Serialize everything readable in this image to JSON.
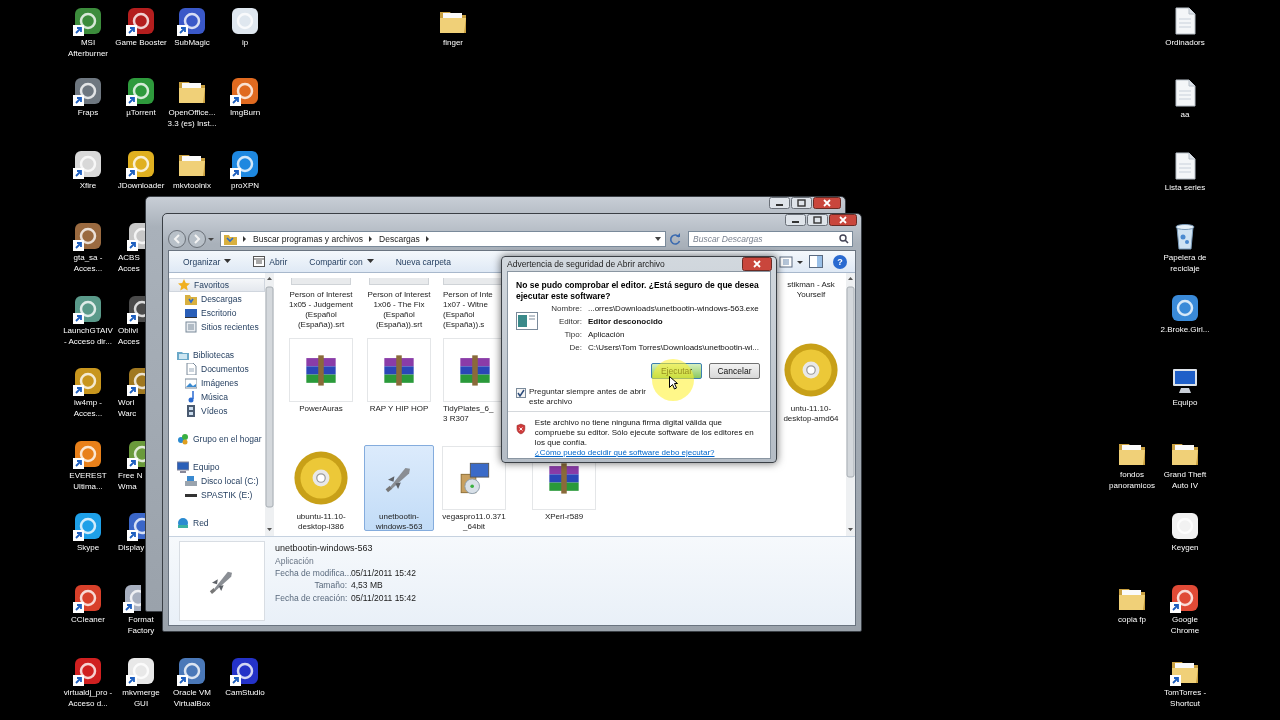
{
  "desktop_icons": [
    {
      "label": "MSI Afterburner",
      "kind": "app",
      "color": "#3c8c3c",
      "shortcut": true
    },
    {
      "label": "Fraps",
      "kind": "app",
      "color": "#6e7780",
      "shortcut": true
    },
    {
      "label": "Xfire",
      "kind": "app",
      "color": "#d8d8d8",
      "shortcut": true
    },
    {
      "label": "gta_sa - Acces...",
      "kind": "app",
      "color": "#9a6a40",
      "shortcut": true
    },
    {
      "label": "LaunchGTAIV - Acceso dir...",
      "kind": "app",
      "color": "#5a9a8a",
      "shortcut": true
    },
    {
      "label": "iw4mp - Acces...",
      "kind": "app",
      "color": "#c8961e",
      "shortcut": true
    },
    {
      "label": "EVEREST Ultima...",
      "kind": "app",
      "color": "#e8801a",
      "shortcut": true
    },
    {
      "label": "Skype",
      "kind": "app",
      "color": "#1ea0e8",
      "shortcut": true
    },
    {
      "label": "CCleaner",
      "kind": "app",
      "color": "#d8402a",
      "shortcut": true
    },
    {
      "label": "virtualdj_pro - Acceso d...",
      "kind": "app",
      "color": "#d02020",
      "shortcut": true
    },
    {
      "label": "Game Booster",
      "kind": "app",
      "color": "#b41e1e",
      "shortcut": true
    },
    {
      "label": "µTorrent",
      "kind": "app",
      "color": "#2e9a3c",
      "shortcut": true
    },
    {
      "label": "JDownloader",
      "kind": "app",
      "color": "#e0b020",
      "shortcut": true
    },
    {
      "label": "ACBS Acces",
      "kind": "app",
      "color": "#c8c8c8",
      "shortcut": true
    },
    {
      "label": "Oblivi Acces",
      "kind": "app",
      "color": "#4a4a4a",
      "shortcut": true
    },
    {
      "label": "Worl Warc",
      "kind": "app",
      "color": "#a07820",
      "shortcut": true
    },
    {
      "label": "Free N Wma",
      "kind": "app",
      "color": "#6a9a3a",
      "shortcut": true
    },
    {
      "label": "Display",
      "kind": "app",
      "color": "#3a66c8",
      "shortcut": true
    },
    {
      "label": "Format Factory",
      "kind": "app",
      "color": "#a8b0c0",
      "shortcut": true
    },
    {
      "label": "mkvmerge GUI",
      "kind": "app",
      "color": "#e8e8e8",
      "shortcut": true
    },
    {
      "label": "SubMagic",
      "kind": "app",
      "color": "#3a58c8",
      "shortcut": true
    },
    {
      "label": "OpenOffice... 3.3 (es) Inst...",
      "kind": "folder",
      "shortcut": false
    },
    {
      "label": "mkvtoolnix",
      "kind": "folder",
      "shortcut": false
    },
    {
      "label": "Oracle VM VirtualBox",
      "kind": "app",
      "color": "#4a78b8",
      "shortcut": true
    },
    {
      "label": "ip",
      "kind": "app",
      "color": "#dfe7ef",
      "shortcut": false
    },
    {
      "label": "ImgBurn",
      "kind": "app",
      "color": "#e06a20",
      "shortcut": true
    },
    {
      "label": "proXPN",
      "kind": "app",
      "color": "#1e88e0",
      "shortcut": true
    },
    {
      "label": "CamStudio",
      "kind": "app",
      "color": "#2432c8",
      "shortcut": true
    },
    {
      "label": "finger",
      "kind": "folder",
      "shortcut": false
    },
    {
      "label": "Ordinadors",
      "kind": "document",
      "shortcut": false
    },
    {
      "label": "aa",
      "kind": "document",
      "shortcut": false
    },
    {
      "label": "Lista series",
      "kind": "document",
      "shortcut": false
    },
    {
      "label": "Papelera de reciclaje",
      "kind": "trash",
      "shortcut": false
    },
    {
      "label": "2.Broke.Girl...",
      "kind": "app",
      "color": "#3a8ad8",
      "shortcut": false
    },
    {
      "label": "Equipo",
      "kind": "computer",
      "shortcut": false
    },
    {
      "label": "fondos panoramicos",
      "kind": "folder",
      "shortcut": false
    },
    {
      "label": "Grand Theft Auto IV",
      "kind": "folder",
      "shortcut": false
    },
    {
      "label": "Keygen",
      "kind": "app",
      "color": "#f2f2f2",
      "shortcut": false
    },
    {
      "label": "copia fp",
      "kind": "folder",
      "shortcut": false
    },
    {
      "label": "Google Chrome",
      "kind": "app",
      "color": "#e04a36",
      "shortcut": true
    },
    {
      "label": "TomTorres - Shortcut",
      "kind": "folder",
      "shortcut": true
    }
  ],
  "explorer": {
    "address": [
      "Buscar programas y archivos",
      "Descargas"
    ],
    "search_placeholder": "Buscar Descargas",
    "toolbar": [
      {
        "label": "Organizar",
        "dropdown": true,
        "has_icon": false
      },
      {
        "label": "Abrir",
        "dropdown": false,
        "has_icon": true
      },
      {
        "label": "Compartir con",
        "dropdown": true,
        "has_icon": false
      },
      {
        "label": "Nueva carpeta",
        "dropdown": false,
        "has_icon": false
      }
    ],
    "help_label": "?",
    "nav": [
      {
        "label": "Favoritos",
        "kind": "favorites",
        "selected": true,
        "children": [
          {
            "label": "Descargas",
            "kind": "downloads",
            "selected": false
          },
          {
            "label": "Escritorio",
            "kind": "desktop",
            "selected": false
          },
          {
            "label": "Sitios recientes",
            "kind": "recent",
            "selected": false
          }
        ]
      },
      {
        "label": "Bibliotecas",
        "kind": "library",
        "selected": false,
        "children": [
          {
            "label": "Documentos",
            "kind": "documents",
            "selected": false
          },
          {
            "label": "Imágenes",
            "kind": "pictures",
            "selected": false
          },
          {
            "label": "Música",
            "kind": "music",
            "selected": false
          },
          {
            "label": "Vídeos",
            "kind": "videos",
            "selected": false
          }
        ]
      },
      {
        "label": "Grupo en el hogar",
        "kind": "homegroup",
        "selected": false
      },
      {
        "label": "Equipo",
        "kind": "computer",
        "selected": false,
        "children": [
          {
            "label": "Disco local (C:)",
            "kind": "disk",
            "selected": false
          },
          {
            "label": "SPASTIK (E:)",
            "kind": "drive",
            "selected": false
          }
        ]
      },
      {
        "label": "Red",
        "kind": "network",
        "selected": false
      }
    ],
    "files": [
      {
        "label": "Person of Interest 1x05 - Judgement (Español (España)).srt",
        "kind": "subtitle",
        "selected": false
      },
      {
        "label": "Person of Interest 1x06 - The Fix (Español (España)).srt",
        "kind": "subtitle",
        "selected": false
      },
      {
        "label": "Person of Inte 1x07 - Witne (Español (España)).s",
        "kind": "subtitle",
        "selected": false
      },
      {
        "label": "stikman - Ask Yourself",
        "selected": false
      },
      {
        "label": "PowerAuras",
        "kind": "archive",
        "selected": false
      },
      {
        "label": "RAP Y HIP HOP",
        "kind": "archive",
        "selected": false
      },
      {
        "label": "TidyPlates_6_3 R307",
        "kind": "archive",
        "selected": false
      },
      {
        "label": "untu-11.10-desktop-amd64",
        "kind": "disc",
        "selected": false
      },
      {
        "label": "ubuntu-11.10-desktop-i386",
        "kind": "disc",
        "selected": false
      },
      {
        "label": "unetbootin-windows-563",
        "kind": "application",
        "selected": true
      },
      {
        "label": "vegaspro11.0.371_64bit",
        "kind": "installer",
        "selected": false
      },
      {
        "label": "XPerl-r589",
        "kind": "archive",
        "selected": false
      }
    ],
    "details": {
      "name": "unetbootin-windows-563",
      "type": "Aplicación",
      "kind": "application",
      "properties": [
        {
          "label": "Fecha de modifica...",
          "value": "05/11/2011 15:42"
        },
        {
          "label": "Tamaño:",
          "value": "4,53 MB"
        },
        {
          "label": "Fecha de creación:",
          "value": "05/11/2011 15:42"
        }
      ]
    }
  },
  "dialog": {
    "title": "Advertencia de seguridad de Abrir archivo",
    "heading": "No se pudo comprobar el editor. ¿Está seguro de que desea ejecutar este software?",
    "fields": [
      {
        "label": "Nombre:",
        "value": "...orres\\Downloads\\unetbootin-windows-563.exe",
        "bold": false
      },
      {
        "label": "Editor:",
        "value": "Editor desconocido",
        "bold": true
      },
      {
        "label": "Tipo:",
        "value": "Aplicación",
        "bold": false
      },
      {
        "label": "De:",
        "value": "C:\\Users\\Tom Torres\\Downloads\\unetbootin-wi...",
        "bold": false
      }
    ],
    "buttons": [
      {
        "label": "Ejecutar",
        "hovered": true
      },
      {
        "label": "Cancelar",
        "hovered": false
      }
    ],
    "always_ask": {
      "label": "Preguntar siempre antes de abrir este archivo",
      "checked": true
    },
    "warning": "Este archivo no tiene ninguna firma digital válida que compruebe su editor. Sólo ejecute software de los editores en los que confía.",
    "link": "¿Cómo puedo decidir qué software debo ejecutar?"
  }
}
